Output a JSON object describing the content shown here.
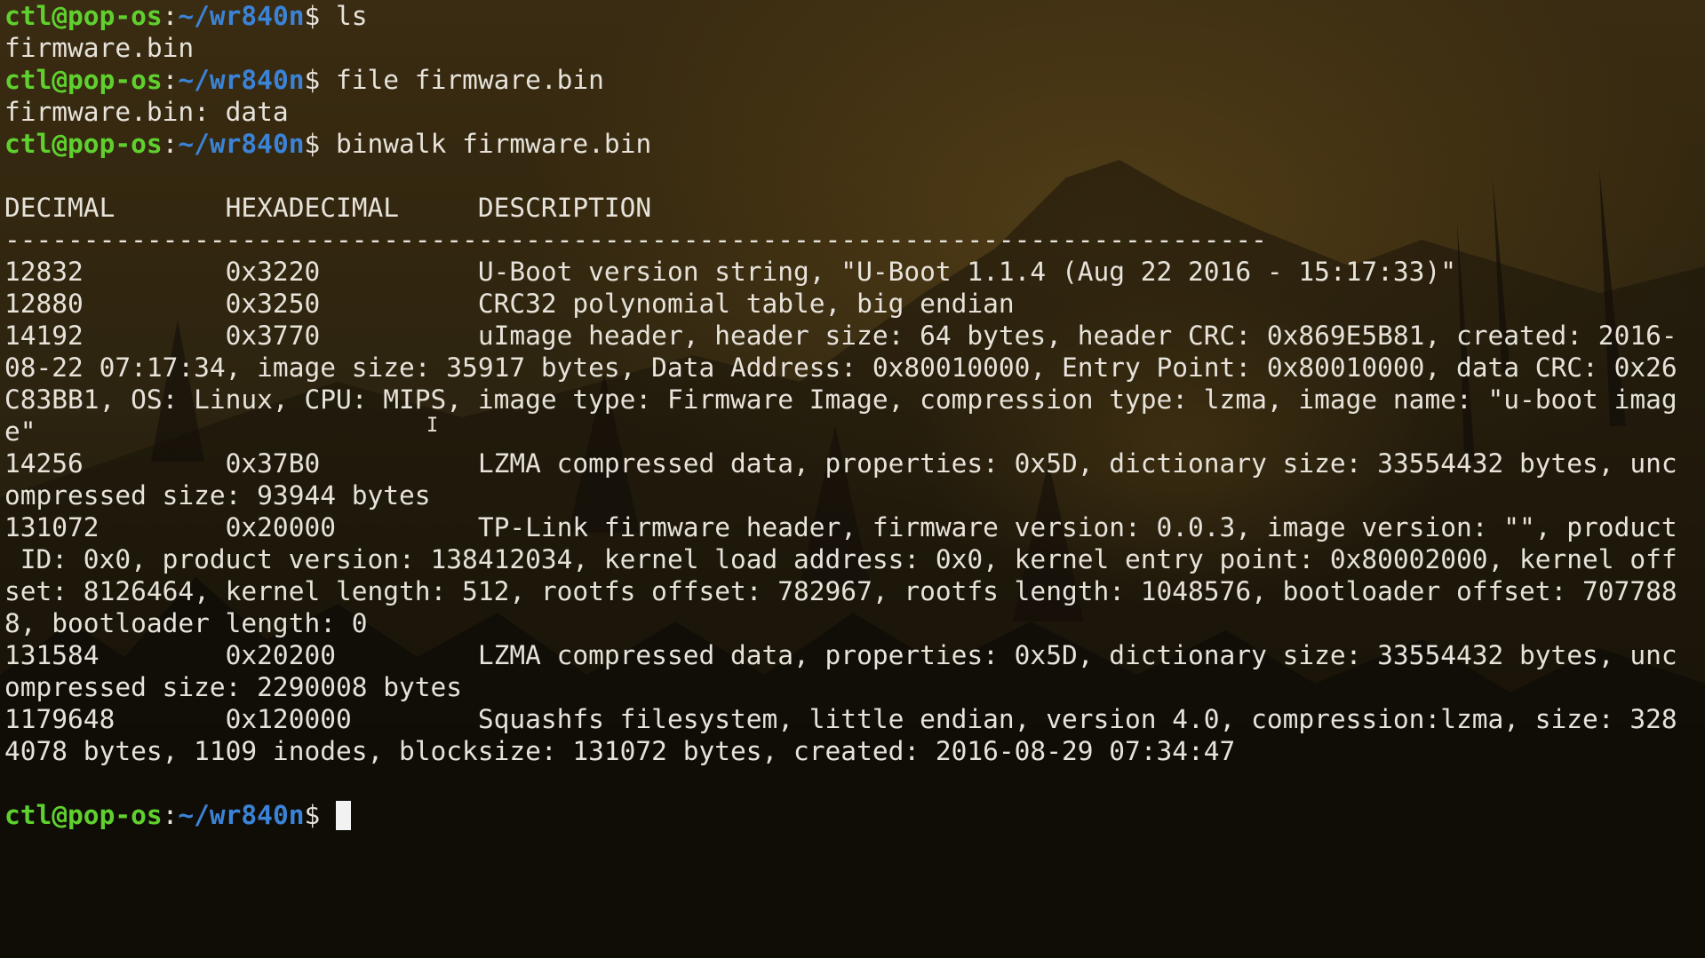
{
  "prompt": {
    "user_host": "ctl@pop-os",
    "separator": ":",
    "path": "~/wr840n",
    "symbol": "$ "
  },
  "colors": {
    "prompt_user": "#5fd02e",
    "prompt_path": "#3b83d6",
    "text": "#e7e3da",
    "cursor": "#f2f2f2"
  },
  "lines": [
    {
      "type": "prompt",
      "command": "ls"
    },
    {
      "type": "output",
      "text": "firmware.bin"
    },
    {
      "type": "prompt",
      "command": "file firmware.bin"
    },
    {
      "type": "output",
      "text": "firmware.bin: data"
    },
    {
      "type": "prompt",
      "command": "binwalk firmware.bin"
    },
    {
      "type": "output",
      "text": ""
    },
    {
      "type": "output",
      "text": "DECIMAL       HEXADECIMAL     DESCRIPTION"
    },
    {
      "type": "output",
      "text": "--------------------------------------------------------------------------------"
    },
    {
      "type": "output",
      "text": "12832         0x3220          U-Boot version string, \"U-Boot 1.1.4 (Aug 22 2016 - 15:17:33)\""
    },
    {
      "type": "output",
      "text": "12880         0x3250          CRC32 polynomial table, big endian"
    },
    {
      "type": "output",
      "text": "14192         0x3770          uImage header, header size: 64 bytes, header CRC: 0x869E5B81, created: 2016-"
    },
    {
      "type": "output",
      "text": "08-22 07:17:34, image size: 35917 bytes, Data Address: 0x80010000, Entry Point: 0x80010000, data CRC: 0x26"
    },
    {
      "type": "output",
      "text": "C83BB1, OS: Linux, CPU: MIPS, image type: Firmware Image, compression type: lzma, image name: \"u-boot imag"
    },
    {
      "type": "output",
      "text": "e\""
    },
    {
      "type": "output",
      "text": "14256         0x37B0          LZMA compressed data, properties: 0x5D, dictionary size: 33554432 bytes, unc"
    },
    {
      "type": "output",
      "text": "ompressed size: 93944 bytes"
    },
    {
      "type": "output",
      "text": "131072        0x20000         TP-Link firmware header, firmware version: 0.0.3, image version: \"\", product"
    },
    {
      "type": "output",
      "text": " ID: 0x0, product version: 138412034, kernel load address: 0x0, kernel entry point: 0x80002000, kernel off"
    },
    {
      "type": "output",
      "text": "set: 8126464, kernel length: 512, rootfs offset: 782967, rootfs length: 1048576, bootloader offset: 707788"
    },
    {
      "type": "output",
      "text": "8, bootloader length: 0"
    },
    {
      "type": "output",
      "text": "131584        0x20200         LZMA compressed data, properties: 0x5D, dictionary size: 33554432 bytes, unc"
    },
    {
      "type": "output",
      "text": "ompressed size: 2290008 bytes"
    },
    {
      "type": "output",
      "text": "1179648       0x120000        Squashfs filesystem, little endian, version 4.0, compression:lzma, size: 328"
    },
    {
      "type": "output",
      "text": "4078 bytes, 1109 inodes, blocksize: 131072 bytes, created: 2016-08-29 07:34:47"
    },
    {
      "type": "output",
      "text": ""
    },
    {
      "type": "prompt",
      "command": "",
      "cursor": true
    }
  ],
  "mouse_pointer": "text-ibeam-icon"
}
